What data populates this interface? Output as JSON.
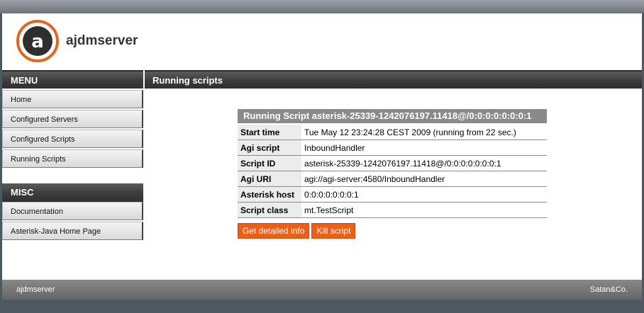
{
  "site": {
    "title": "ajdmserver"
  },
  "menu": {
    "heading": "MENU",
    "items": [
      {
        "label": "Home"
      },
      {
        "label": "Configured Servers"
      },
      {
        "label": "Configured Scripts"
      },
      {
        "label": "Running Scripts"
      }
    ]
  },
  "misc": {
    "heading": "MISC",
    "items": [
      {
        "label": "Documentation"
      },
      {
        "label": "Asterisk-Java Home Page"
      }
    ]
  },
  "content": {
    "heading": "Running scripts",
    "table": {
      "caption": "Running Script asterisk-25339-1242076197.11418@/0:0:0:0:0:0:0:1",
      "rows": [
        {
          "key": "Start time",
          "value": "Tue May 12 23:24:28 CEST 2009 (running from 22 sec.)"
        },
        {
          "key": "Agi script",
          "value": "InboundHandler"
        },
        {
          "key": "Script ID",
          "value": "asterisk-25339-1242076197.11418@/0:0:0:0:0:0:0:1"
        },
        {
          "key": "Agi URI",
          "value": "agi://agi-server:4580/InboundHandler"
        },
        {
          "key": "Asterisk host",
          "value": "0:0:0:0:0:0:0:1"
        },
        {
          "key": "Script class",
          "value": "mt.TestScript"
        }
      ]
    },
    "buttons": {
      "details": "Get detailed info",
      "kill": "Kill script"
    }
  },
  "footer": {
    "left": "ajdmserver",
    "right": "Satan&Co."
  },
  "colors": {
    "accent": "#ec5f16",
    "header_bar": "#3a3a3a",
    "caption_bg": "#8a8a8a"
  }
}
